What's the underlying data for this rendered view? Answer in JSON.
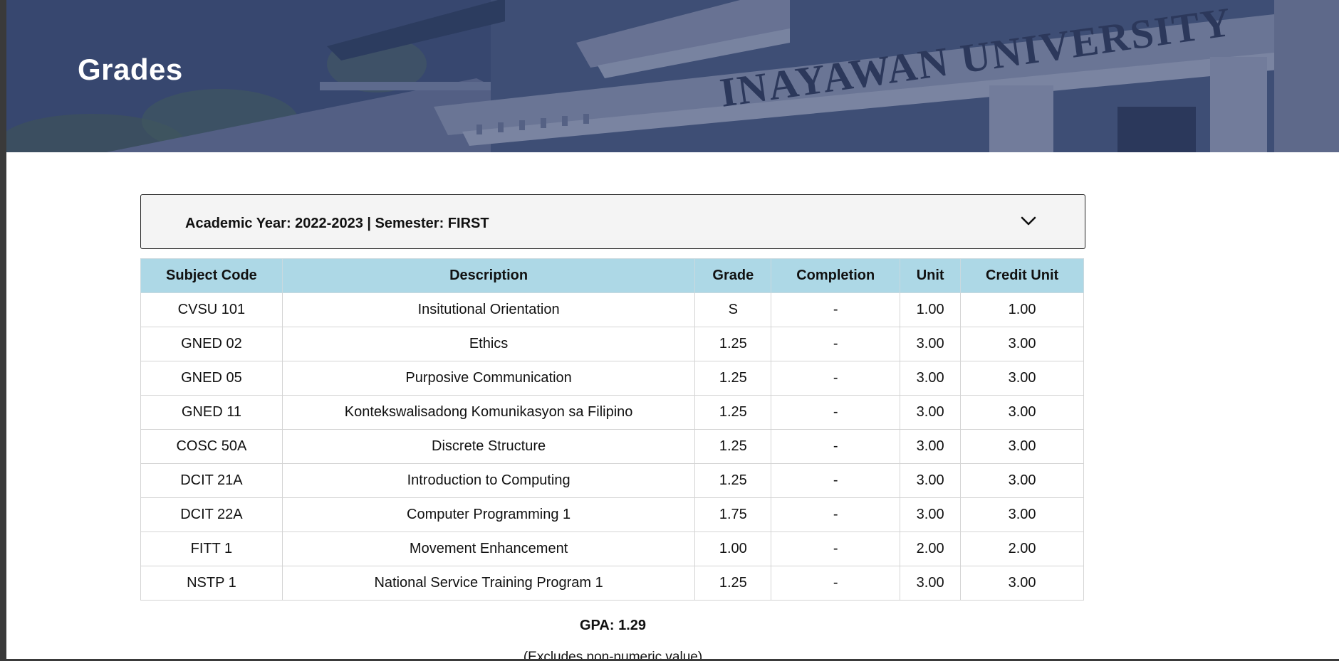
{
  "header": {
    "title": "Grades",
    "banner_text": "INAYAWAN UNIVERSITY"
  },
  "term_selector": {
    "label": "Academic Year: 2022-2023 | Semester: FIRST",
    "icon": "chevron-down-icon"
  },
  "table": {
    "headers": [
      "Subject Code",
      "Description",
      "Grade",
      "Completion",
      "Unit",
      "Credit Unit"
    ],
    "rows": [
      {
        "code": "CVSU 101",
        "description": "Insitutional Orientation",
        "grade": "S",
        "completion": "-",
        "unit": "1.00",
        "credit": "1.00"
      },
      {
        "code": "GNED 02",
        "description": "Ethics",
        "grade": "1.25",
        "completion": "-",
        "unit": "3.00",
        "credit": "3.00"
      },
      {
        "code": "GNED 05",
        "description": "Purposive Communication",
        "grade": "1.25",
        "completion": "-",
        "unit": "3.00",
        "credit": "3.00"
      },
      {
        "code": "GNED 11",
        "description": "Kontekswalisadong Komunikasyon sa Filipino",
        "grade": "1.25",
        "completion": "-",
        "unit": "3.00",
        "credit": "3.00"
      },
      {
        "code": "COSC 50A",
        "description": "Discrete Structure",
        "grade": "1.25",
        "completion": "-",
        "unit": "3.00",
        "credit": "3.00"
      },
      {
        "code": "DCIT 21A",
        "description": "Introduction to Computing",
        "grade": "1.25",
        "completion": "-",
        "unit": "3.00",
        "credit": "3.00"
      },
      {
        "code": "DCIT 22A",
        "description": "Computer Programming 1",
        "grade": "1.75",
        "completion": "-",
        "unit": "3.00",
        "credit": "3.00"
      },
      {
        "code": "FITT 1",
        "description": "Movement Enhancement",
        "grade": "1.00",
        "completion": "-",
        "unit": "2.00",
        "credit": "2.00"
      },
      {
        "code": "NSTP 1",
        "description": "National Service Training Program 1",
        "grade": "1.25",
        "completion": "-",
        "unit": "3.00",
        "credit": "3.00"
      }
    ]
  },
  "summary": {
    "gpa": "GPA: 1.29",
    "note": "(Excludes non-numeric value)"
  },
  "colors": {
    "header_bg": "#add8e6",
    "banner_overlay": "#3a4f74"
  }
}
